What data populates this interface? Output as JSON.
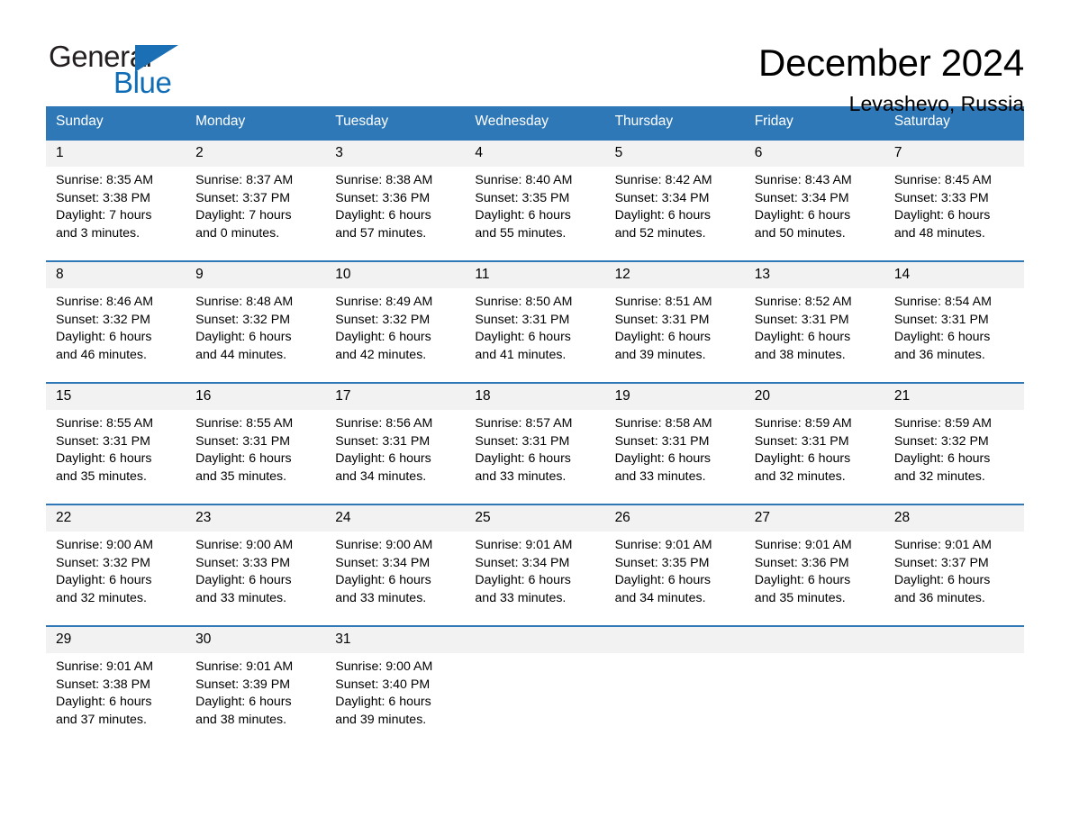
{
  "logo": {
    "word1": "General",
    "word2": "Blue",
    "triangle_color": "#1b6fb5",
    "word2_color": "#0f6cb5"
  },
  "header": {
    "title": "December 2024",
    "location": "Levashevo, Russia"
  },
  "theme": {
    "header_blue": "#2e78b8",
    "day_band_gray": "#f2f2f2"
  },
  "weekdays": [
    "Sunday",
    "Monday",
    "Tuesday",
    "Wednesday",
    "Thursday",
    "Friday",
    "Saturday"
  ],
  "labels": {
    "sunrise": "Sunrise:",
    "sunset": "Sunset:",
    "daylight": "Daylight:"
  },
  "weeks": [
    [
      {
        "day": "1",
        "sunrise": "Sunrise: 8:35 AM",
        "sunset": "Sunset: 3:38 PM",
        "daylight_line1": "Daylight: 7 hours",
        "daylight_line2": "and 3 minutes."
      },
      {
        "day": "2",
        "sunrise": "Sunrise: 8:37 AM",
        "sunset": "Sunset: 3:37 PM",
        "daylight_line1": "Daylight: 7 hours",
        "daylight_line2": "and 0 minutes."
      },
      {
        "day": "3",
        "sunrise": "Sunrise: 8:38 AM",
        "sunset": "Sunset: 3:36 PM",
        "daylight_line1": "Daylight: 6 hours",
        "daylight_line2": "and 57 minutes."
      },
      {
        "day": "4",
        "sunrise": "Sunrise: 8:40 AM",
        "sunset": "Sunset: 3:35 PM",
        "daylight_line1": "Daylight: 6 hours",
        "daylight_line2": "and 55 minutes."
      },
      {
        "day": "5",
        "sunrise": "Sunrise: 8:42 AM",
        "sunset": "Sunset: 3:34 PM",
        "daylight_line1": "Daylight: 6 hours",
        "daylight_line2": "and 52 minutes."
      },
      {
        "day": "6",
        "sunrise": "Sunrise: 8:43 AM",
        "sunset": "Sunset: 3:34 PM",
        "daylight_line1": "Daylight: 6 hours",
        "daylight_line2": "and 50 minutes."
      },
      {
        "day": "7",
        "sunrise": "Sunrise: 8:45 AM",
        "sunset": "Sunset: 3:33 PM",
        "daylight_line1": "Daylight: 6 hours",
        "daylight_line2": "and 48 minutes."
      }
    ],
    [
      {
        "day": "8",
        "sunrise": "Sunrise: 8:46 AM",
        "sunset": "Sunset: 3:32 PM",
        "daylight_line1": "Daylight: 6 hours",
        "daylight_line2": "and 46 minutes."
      },
      {
        "day": "9",
        "sunrise": "Sunrise: 8:48 AM",
        "sunset": "Sunset: 3:32 PM",
        "daylight_line1": "Daylight: 6 hours",
        "daylight_line2": "and 44 minutes."
      },
      {
        "day": "10",
        "sunrise": "Sunrise: 8:49 AM",
        "sunset": "Sunset: 3:32 PM",
        "daylight_line1": "Daylight: 6 hours",
        "daylight_line2": "and 42 minutes."
      },
      {
        "day": "11",
        "sunrise": "Sunrise: 8:50 AM",
        "sunset": "Sunset: 3:31 PM",
        "daylight_line1": "Daylight: 6 hours",
        "daylight_line2": "and 41 minutes."
      },
      {
        "day": "12",
        "sunrise": "Sunrise: 8:51 AM",
        "sunset": "Sunset: 3:31 PM",
        "daylight_line1": "Daylight: 6 hours",
        "daylight_line2": "and 39 minutes."
      },
      {
        "day": "13",
        "sunrise": "Sunrise: 8:52 AM",
        "sunset": "Sunset: 3:31 PM",
        "daylight_line1": "Daylight: 6 hours",
        "daylight_line2": "and 38 minutes."
      },
      {
        "day": "14",
        "sunrise": "Sunrise: 8:54 AM",
        "sunset": "Sunset: 3:31 PM",
        "daylight_line1": "Daylight: 6 hours",
        "daylight_line2": "and 36 minutes."
      }
    ],
    [
      {
        "day": "15",
        "sunrise": "Sunrise: 8:55 AM",
        "sunset": "Sunset: 3:31 PM",
        "daylight_line1": "Daylight: 6 hours",
        "daylight_line2": "and 35 minutes."
      },
      {
        "day": "16",
        "sunrise": "Sunrise: 8:55 AM",
        "sunset": "Sunset: 3:31 PM",
        "daylight_line1": "Daylight: 6 hours",
        "daylight_line2": "and 35 minutes."
      },
      {
        "day": "17",
        "sunrise": "Sunrise: 8:56 AM",
        "sunset": "Sunset: 3:31 PM",
        "daylight_line1": "Daylight: 6 hours",
        "daylight_line2": "and 34 minutes."
      },
      {
        "day": "18",
        "sunrise": "Sunrise: 8:57 AM",
        "sunset": "Sunset: 3:31 PM",
        "daylight_line1": "Daylight: 6 hours",
        "daylight_line2": "and 33 minutes."
      },
      {
        "day": "19",
        "sunrise": "Sunrise: 8:58 AM",
        "sunset": "Sunset: 3:31 PM",
        "daylight_line1": "Daylight: 6 hours",
        "daylight_line2": "and 33 minutes."
      },
      {
        "day": "20",
        "sunrise": "Sunrise: 8:59 AM",
        "sunset": "Sunset: 3:31 PM",
        "daylight_line1": "Daylight: 6 hours",
        "daylight_line2": "and 32 minutes."
      },
      {
        "day": "21",
        "sunrise": "Sunrise: 8:59 AM",
        "sunset": "Sunset: 3:32 PM",
        "daylight_line1": "Daylight: 6 hours",
        "daylight_line2": "and 32 minutes."
      }
    ],
    [
      {
        "day": "22",
        "sunrise": "Sunrise: 9:00 AM",
        "sunset": "Sunset: 3:32 PM",
        "daylight_line1": "Daylight: 6 hours",
        "daylight_line2": "and 32 minutes."
      },
      {
        "day": "23",
        "sunrise": "Sunrise: 9:00 AM",
        "sunset": "Sunset: 3:33 PM",
        "daylight_line1": "Daylight: 6 hours",
        "daylight_line2": "and 33 minutes."
      },
      {
        "day": "24",
        "sunrise": "Sunrise: 9:00 AM",
        "sunset": "Sunset: 3:34 PM",
        "daylight_line1": "Daylight: 6 hours",
        "daylight_line2": "and 33 minutes."
      },
      {
        "day": "25",
        "sunrise": "Sunrise: 9:01 AM",
        "sunset": "Sunset: 3:34 PM",
        "daylight_line1": "Daylight: 6 hours",
        "daylight_line2": "and 33 minutes."
      },
      {
        "day": "26",
        "sunrise": "Sunrise: 9:01 AM",
        "sunset": "Sunset: 3:35 PM",
        "daylight_line1": "Daylight: 6 hours",
        "daylight_line2": "and 34 minutes."
      },
      {
        "day": "27",
        "sunrise": "Sunrise: 9:01 AM",
        "sunset": "Sunset: 3:36 PM",
        "daylight_line1": "Daylight: 6 hours",
        "daylight_line2": "and 35 minutes."
      },
      {
        "day": "28",
        "sunrise": "Sunrise: 9:01 AM",
        "sunset": "Sunset: 3:37 PM",
        "daylight_line1": "Daylight: 6 hours",
        "daylight_line2": "and 36 minutes."
      }
    ],
    [
      {
        "day": "29",
        "sunrise": "Sunrise: 9:01 AM",
        "sunset": "Sunset: 3:38 PM",
        "daylight_line1": "Daylight: 6 hours",
        "daylight_line2": "and 37 minutes."
      },
      {
        "day": "30",
        "sunrise": "Sunrise: 9:01 AM",
        "sunset": "Sunset: 3:39 PM",
        "daylight_line1": "Daylight: 6 hours",
        "daylight_line2": "and 38 minutes."
      },
      {
        "day": "31",
        "sunrise": "Sunrise: 9:00 AM",
        "sunset": "Sunset: 3:40 PM",
        "daylight_line1": "Daylight: 6 hours",
        "daylight_line2": "and 39 minutes."
      },
      {
        "day": "",
        "sunrise": "",
        "sunset": "",
        "daylight_line1": "",
        "daylight_line2": ""
      },
      {
        "day": "",
        "sunrise": "",
        "sunset": "",
        "daylight_line1": "",
        "daylight_line2": ""
      },
      {
        "day": "",
        "sunrise": "",
        "sunset": "",
        "daylight_line1": "",
        "daylight_line2": ""
      },
      {
        "day": "",
        "sunrise": "",
        "sunset": "",
        "daylight_line1": "",
        "daylight_line2": ""
      }
    ]
  ]
}
